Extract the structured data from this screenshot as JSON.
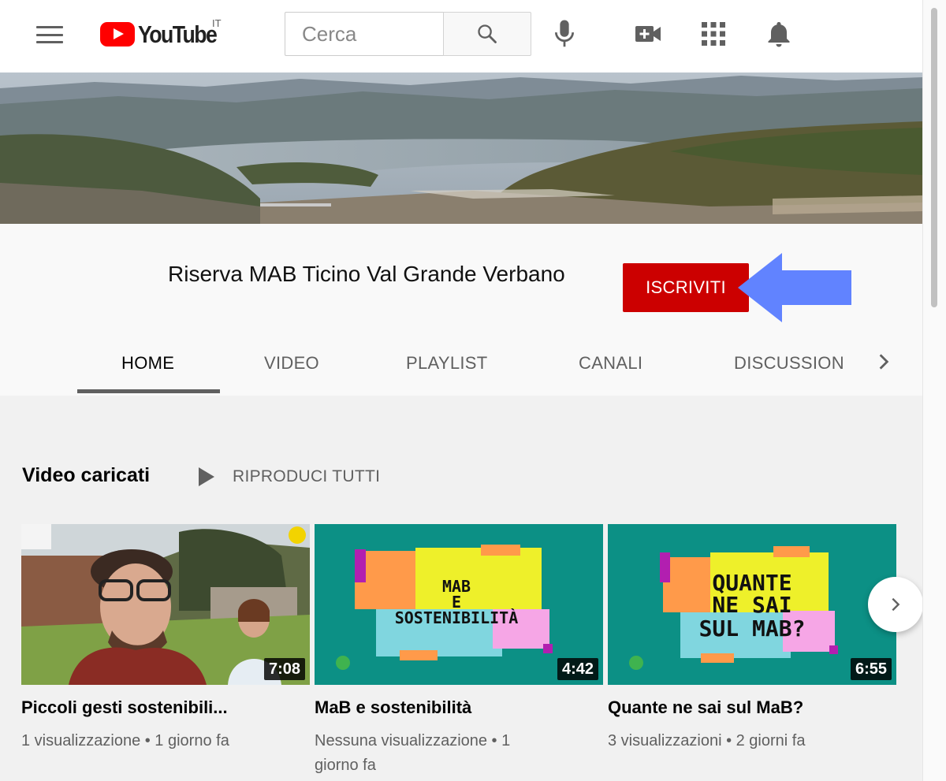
{
  "header": {
    "logo_text": "YouTube",
    "country_code": "IT",
    "search_placeholder": "Cerca"
  },
  "channel": {
    "name": "Riserva MAB Ticino Val Grande Verbano",
    "subscribe_label": "ISCRIVITI"
  },
  "tabs": [
    {
      "label": "HOME"
    },
    {
      "label": "VIDEO"
    },
    {
      "label": "PLAYLIST"
    },
    {
      "label": "CANALI"
    },
    {
      "label": "DISCUSSION"
    }
  ],
  "section": {
    "title": "Video caricati",
    "play_all_label": "RIPRODUCI TUTTI"
  },
  "videos": [
    {
      "title": "Piccoli gesti sostenibili...",
      "meta": "1 visualizzazione • 1 giorno fa",
      "duration": "7:08"
    },
    {
      "title": "MaB e sostenibilità",
      "meta": "Nessuna visualizzazione • 1 giorno fa",
      "duration": "4:42",
      "thumb_text": [
        "MAB",
        "E",
        "SOSTENIBILITÀ"
      ]
    },
    {
      "title": "Quante ne sai sul MaB?",
      "meta": "3 visualizzazioni • 2 giorni fa",
      "duration": "6:55",
      "thumb_text": [
        "QUANTE",
        "NE SAI",
        "SUL MAB?"
      ]
    }
  ],
  "colors": {
    "accent_red": "#cc0000",
    "arrow_blue": "#6183ff",
    "thumb_teal": "#0c9085"
  },
  "icons": [
    "menu-icon",
    "search-icon",
    "microphone-icon",
    "video-camera-icon",
    "apps-grid-icon",
    "bell-icon",
    "chevron-right-icon",
    "play-icon"
  ]
}
